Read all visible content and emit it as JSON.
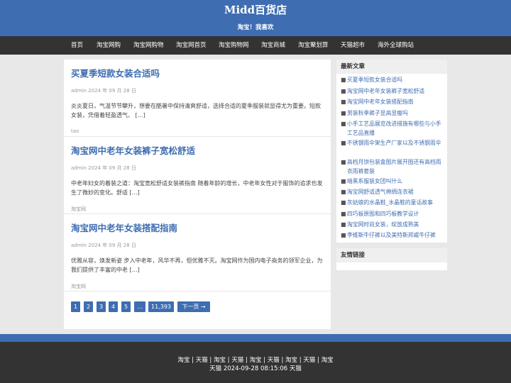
{
  "header": {
    "title": "Midd百货店",
    "description": "淘宝！我喜欢"
  },
  "nav": {
    "items": [
      "首页",
      "淘宝网购",
      "淘宝网购物",
      "淘宝网首页",
      "淘宝购物网",
      "淘宝商城",
      "淘宝聚划算",
      "天猫超市",
      "海外全球购站"
    ]
  },
  "posts": [
    {
      "title": "买夏季短款女装合适吗",
      "meta": "admin 2024 年 09 月 28 日",
      "excerpt": "炎炎夏日，气温节节攀升，想要在酷暑中保持清爽舒适，选择合适的夏季服装就显得尤为重要。短款女装，凭借着轻盈透气、 […]",
      "category": "tao"
    },
    {
      "title": "淘宝网中老年女装裤子宽松舒适",
      "meta": "admin 2024 年 09 月 28 日",
      "excerpt": "中老年妇女的着装之道：淘宝宽松舒适女装裤指南 随着年龄的增长，中老年女性对于服饰的追求也发生了微妙的变化。舒适 […]",
      "category": "淘宝网"
    },
    {
      "title": "淘宝网中老年女装搭配指南",
      "meta": "admin 2024 年 09 月 28 日",
      "excerpt": "优雅从容，焕发新姿 步入中老年，风华不再，但优雅不灭。淘宝网作为国内电子商务的领军企业，为我们提供了丰富的中老 […]",
      "category": "淘宝网"
    }
  ],
  "pagination": {
    "pages": [
      "1",
      "2",
      "3",
      "4",
      "5",
      "…",
      "11,393"
    ],
    "next": "下一页 →"
  },
  "sidebar": {
    "recent_title": "最新文章",
    "recent_posts": [
      "买夏季短款女装合适吗",
      "淘宝网中老年女装裤子宽松舒适",
      "淘宝网中老年女装搭配指南",
      "男装秋季裤子显高显瘦吗",
      "小手工艺品展览改进措施有哪些与小手工艺品直播",
      "不锈钢雨伞架生产厂家以及不锈钢雨伞",
      "高档月饼包装盒图片展开图还有高档雨衣雨裤套装",
      "暗黑系服装女团叫什么",
      "淘宝网舒适透气棉绸连衣裙",
      "灰姑娘的水晶鞋_水晶鞋的童话故事",
      "四巧板原图和四巧板教学设计",
      "淘宝网时尚女装，绽放成熟美",
      "李维斯牛仔裤以及美特斯邦威牛仔裤"
    ],
    "links_title": "友情链接"
  },
  "footer": {
    "links": "淘宝 | 天猫 | 淘宝 | 天猫 | 淘宝 | 天猫 | 淘宝 | 天猫 | 淘宝",
    "timestamp": "天猫 2024-09-28 08:15:06 天猫"
  }
}
